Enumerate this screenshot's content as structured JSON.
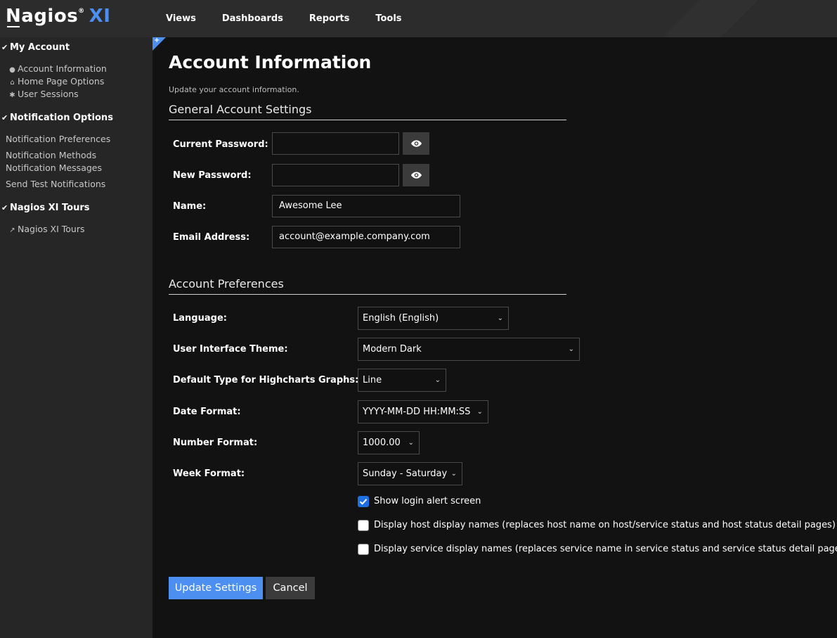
{
  "header": {
    "logo_main": "Nagios",
    "logo_reg": "®",
    "logo_suffix": "XI",
    "nav": [
      "Views",
      "Dashboards",
      "Reports",
      "Tools"
    ]
  },
  "sidebar": {
    "sections": [
      {
        "title": "My Account",
        "items": [
          {
            "label": "Account Information",
            "icon": "user-icon"
          },
          {
            "label": "Home Page Options",
            "icon": "home-icon"
          },
          {
            "label": "User Sessions",
            "icon": "asterisk-icon"
          }
        ]
      },
      {
        "title": "Notification Options",
        "items": [
          {
            "label": "Notification Preferences"
          },
          {
            "label": "Notification Methods"
          },
          {
            "label": "Notification Messages"
          },
          {
            "label": "Send Test Notifications"
          }
        ]
      },
      {
        "title": "Nagios XI Tours",
        "items": [
          {
            "label": "Nagios XI Tours",
            "icon": "external-link-icon"
          }
        ]
      }
    ]
  },
  "main": {
    "title": "Account Information",
    "subtitle": "Update your account information.",
    "general": {
      "title": "General Account Settings",
      "current_password_label": "Current Password:",
      "current_password_value": "",
      "new_password_label": "New Password:",
      "new_password_value": "",
      "name_label": "Name:",
      "name_value": "Awesome Lee",
      "email_label": "Email Address:",
      "email_value": "account@example.company.com"
    },
    "prefs": {
      "title": "Account Preferences",
      "language_label": "Language:",
      "language_value": "English (English)",
      "theme_label": "User Interface Theme:",
      "theme_value": "Modern Dark",
      "chart_type_label": "Default Type for Highcharts Graphs:",
      "chart_type_value": "Line",
      "date_label": "Date Format:",
      "date_value": "YYYY-MM-DD HH:MM:SS",
      "number_label": "Number Format:",
      "number_value": "1000.00",
      "week_label": "Week Format:",
      "week_value": "Sunday - Saturday",
      "checkboxes": [
        {
          "label": "Show login alert screen",
          "checked": true
        },
        {
          "label": "Display host display names (replaces host name on host/service status and host status detail pages)",
          "checked": false
        },
        {
          "label": "Display service display names (replaces service name in service status and service status detail pages)",
          "checked": false
        }
      ]
    },
    "buttons": {
      "update": "Update Settings",
      "cancel": "Cancel"
    }
  },
  "colors": {
    "accent": "#4d8ff0",
    "checkbox_checked": "#1e6fe0",
    "background": "#121212",
    "sidebar": "#262626",
    "topbar": "#2c2c2c"
  }
}
